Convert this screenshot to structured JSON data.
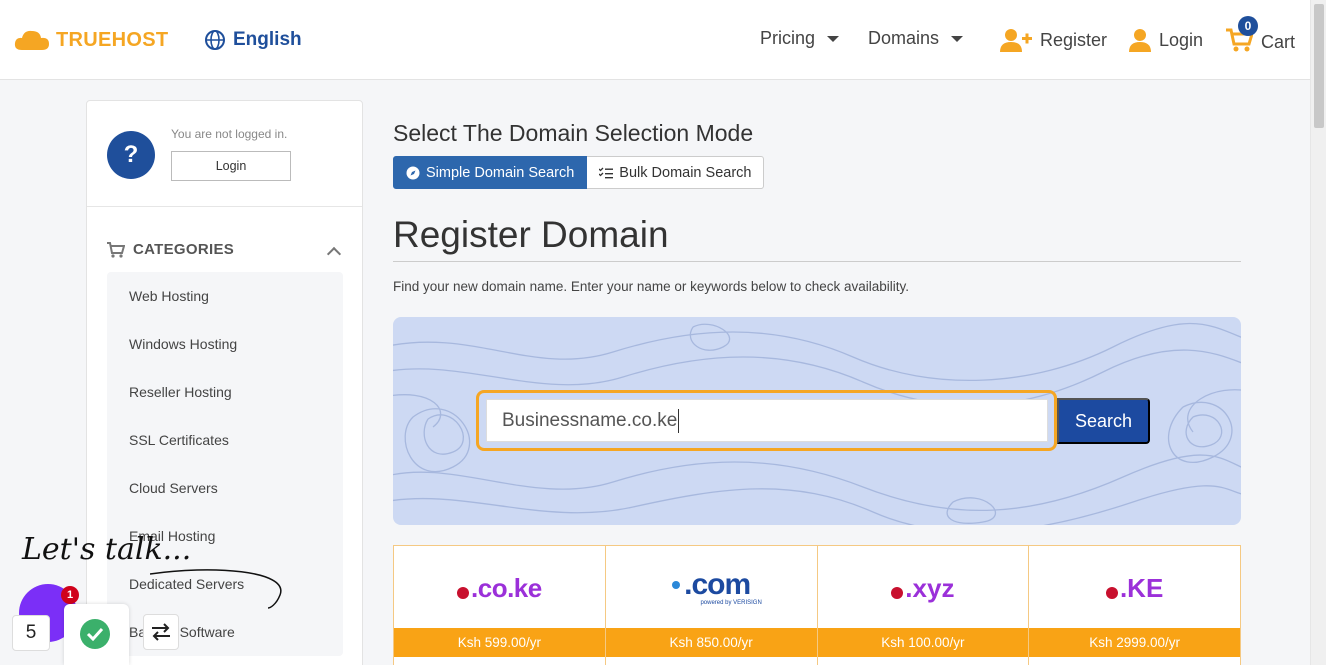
{
  "header": {
    "logo_text": "TRUEHOST",
    "language": "English",
    "nav": {
      "pricing": "Pricing",
      "domains": "Domains",
      "register": "Register",
      "login": "Login",
      "cart": "Cart",
      "cart_count": "0"
    }
  },
  "sidebar": {
    "not_logged_in": "You are not logged in.",
    "login_button": "Login",
    "categories_heading": "CATEGORIES",
    "categories": [
      "Web Hosting",
      "Windows Hosting",
      "Reseller Hosting",
      "SSL Certificates",
      "Cloud Servers",
      "Email Hosting",
      "Dedicated Servers",
      "Backup Software"
    ]
  },
  "main": {
    "mode_title": "Select The Domain Selection Mode",
    "tabs": {
      "simple": "Simple Domain Search",
      "bulk": "Bulk Domain Search"
    },
    "title": "Register Domain",
    "description": "Find your new domain name. Enter your name or keywords below to check availability.",
    "search": {
      "value": "Businessname.co.ke",
      "button": "Search"
    },
    "tlds": [
      {
        "name": ".co.ke",
        "price": "Ksh 599.00/yr"
      },
      {
        "name": ".com",
        "price": "Ksh 850.00/yr"
      },
      {
        "name": ".xyz",
        "price": "Ksh 100.00/yr"
      },
      {
        "name": ".KE",
        "price": "Ksh 2999.00/yr"
      }
    ],
    "com_logo_caption": "powered by VERISIGN"
  },
  "chat_widget": {
    "lets_talk": "Let's talk...",
    "badge_count": "1",
    "number_box": "5"
  },
  "colors": {
    "brand_orange": "#f5a623",
    "brand_blue": "#1f4f9b",
    "search_button": "#1c4aa0",
    "price_bar": "#f9a315",
    "search_panel": "#cdd9f3"
  }
}
